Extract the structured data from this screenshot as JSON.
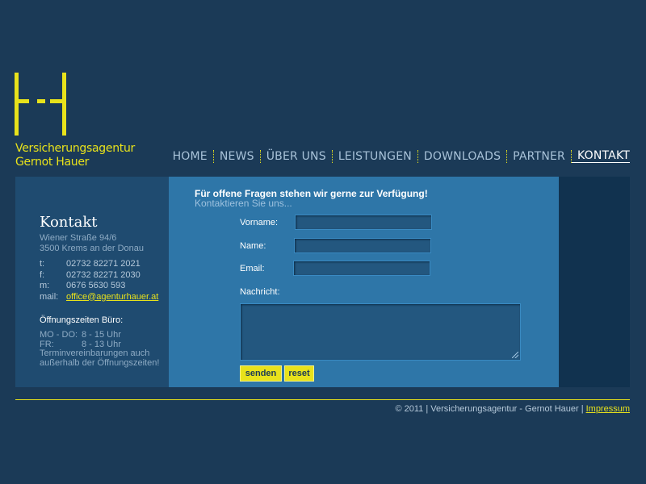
{
  "brand": {
    "line1": "Versicherungsagentur",
    "line2": "Gernot Hauer",
    "accent": "#e8e21b",
    "logo_icon": "h-logo"
  },
  "nav": {
    "items": [
      {
        "label": "HOME"
      },
      {
        "label": "NEWS"
      },
      {
        "label": "ÜBER UNS"
      },
      {
        "label": "LEISTUNGEN"
      },
      {
        "label": "DOWNLOADS"
      },
      {
        "label": "PARTNER"
      },
      {
        "label": "KONTAKT",
        "active": true
      }
    ]
  },
  "sidebar": {
    "title": "Kontakt",
    "address_line1": "Wiener Straße 94/6",
    "address_line2": "3500 Krems an der Donau",
    "contacts": [
      {
        "key": "t:",
        "value": "02732 82271 2021"
      },
      {
        "key": "f:",
        "value": "02732 82271 2030"
      },
      {
        "key": "m:",
        "value": "0676 5630 593"
      },
      {
        "key": "mail:",
        "value": "office@agenturhauer.at"
      }
    ],
    "hours_title": "Öffnungszeiten Büro:",
    "hours": [
      {
        "key": "MO - DO:",
        "value": "8 - 15 Uhr"
      },
      {
        "key": "FR:",
        "value": "8 - 13 Uhr"
      }
    ],
    "hours_note_line1": "Terminvereinbarungen auch",
    "hours_note_line2": "außerhalb der Öffnungszeiten!"
  },
  "content": {
    "headline": "Für offene Fragen stehen wir gerne zur Verfügung!",
    "subline": "Kontaktieren Sie uns...",
    "form": {
      "vorname_label": "Vorname:",
      "vorname_value": "",
      "name_label": "Name:",
      "name_value": "",
      "email_label": "Email:",
      "email_value": "",
      "message_label": "Nachricht:",
      "message_value": "",
      "submit_label": "senden",
      "reset_label": "reset"
    }
  },
  "footer": {
    "copyright": "© 2011 | Versicherungsagentur - Gernot Hauer |",
    "impressum_label": "Impressum"
  }
}
